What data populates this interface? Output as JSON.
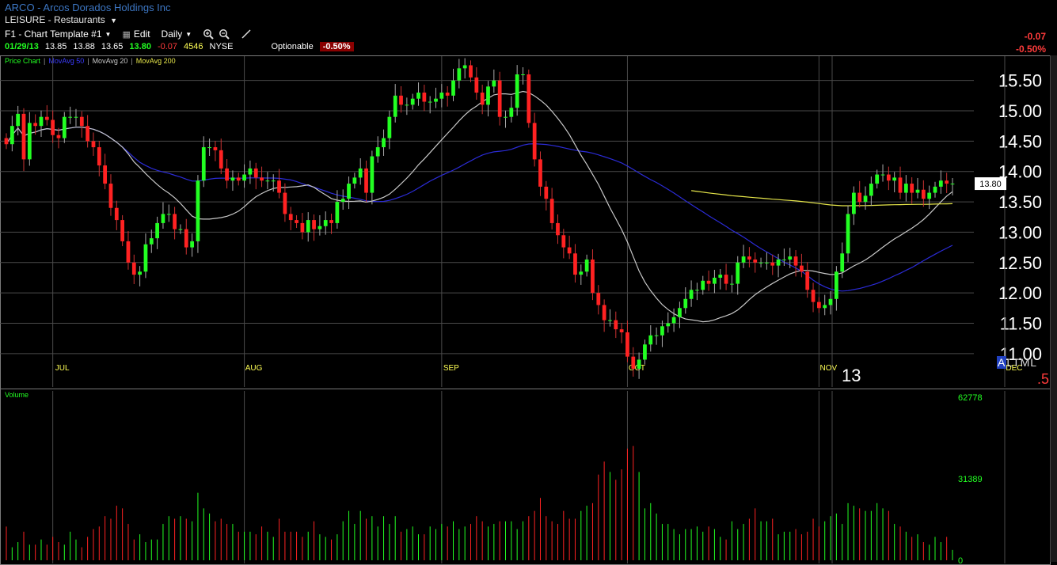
{
  "header": {
    "title": "ARCO - Arcos Dorados Holdings Inc",
    "sector": "LEISURE - Restaurants",
    "template": "F1 - Chart Template #1",
    "edit_label": "Edit",
    "period": "Daily",
    "optionable": "Optionable"
  },
  "quote": {
    "date": "01/29/13",
    "open": "13.85",
    "high": "13.88",
    "low": "13.65",
    "last": "13.80",
    "change": "-0.07",
    "volume": "4546",
    "exchange": "NYSE",
    "pct_change": "-0.50%"
  },
  "right_panel": {
    "change": "-0.07",
    "pct_change": "-0.50%"
  },
  "legend": {
    "price_chart": "Price Chart",
    "ma50": "MovAvg 50",
    "ma20": "MovAvg 20",
    "ma200": "MovAvg 200",
    "volume_label": "Volume"
  },
  "colors": {
    "up": "#22ff22",
    "down": "#ff2222",
    "ma50": "#2b2bd6",
    "ma20": "#c8c8c8",
    "ma200": "#e6e64a",
    "grid": "#4a4a4a"
  },
  "misc": {
    "alt_ml": "ALTML",
    "corner_13": "13",
    "corner_5": ".5"
  },
  "chart_data": [
    {
      "type": "candlestick",
      "ylim": [
        10.45,
        15.9
      ],
      "yticks": [
        "15.50",
        "15.00",
        "14.50",
        "14.00",
        "13.50",
        "13.00",
        "12.50",
        "12.00",
        "11.50",
        "11.00"
      ],
      "month_labels": [
        {
          "label": "JUL",
          "index": 8
        },
        {
          "label": "AUG",
          "index": 41
        },
        {
          "label": "SEP",
          "index": 75
        },
        {
          "label": "OCT",
          "index": 107
        },
        {
          "label": "NOV",
          "index": 140
        },
        {
          "label": "DEC",
          "index": 172
        }
      ],
      "last_price_label": "13.80",
      "closes": [
        14.45,
        14.75,
        14.95,
        14.2,
        14.8,
        14.75,
        14.9,
        14.85,
        14.6,
        14.55,
        14.9,
        14.9,
        14.9,
        14.75,
        14.5,
        14.4,
        14.1,
        13.8,
        13.4,
        13.2,
        12.85,
        12.5,
        12.3,
        12.35,
        12.8,
        12.9,
        13.15,
        13.3,
        13.3,
        13.05,
        13.05,
        12.75,
        12.85,
        13.85,
        14.4,
        14.4,
        14.35,
        14.05,
        13.85,
        13.9,
        13.85,
        13.95,
        14.05,
        13.9,
        13.85,
        13.85,
        13.85,
        13.65,
        13.3,
        13.2,
        13.15,
        13.0,
        13.2,
        13.05,
        13.1,
        13.2,
        13.15,
        13.5,
        13.55,
        13.8,
        13.9,
        14.05,
        13.65,
        14.25,
        14.4,
        14.55,
        14.9,
        15.25,
        15.1,
        15.1,
        15.2,
        15.3,
        15.15,
        15.15,
        15.2,
        15.3,
        15.25,
        15.5,
        15.7,
        15.75,
        15.55,
        15.3,
        15.1,
        15.4,
        15.5,
        14.9,
        14.9,
        15.05,
        15.6,
        15.6,
        14.8,
        14.2,
        13.75,
        13.55,
        13.15,
        12.95,
        12.75,
        12.65,
        12.3,
        12.35,
        12.55,
        12.0,
        11.8,
        11.55,
        11.55,
        11.4,
        11.35,
        10.95,
        10.75,
        10.9,
        11.15,
        11.3,
        11.3,
        11.45,
        11.5,
        11.6,
        11.75,
        11.9,
        12.05,
        12.05,
        12.2,
        12.15,
        12.25,
        12.3,
        12.15,
        12.15,
        12.5,
        12.6,
        12.55,
        12.5,
        12.5,
        12.5,
        12.45,
        12.55,
        12.55,
        12.6,
        12.45,
        12.35,
        12.05,
        11.85,
        11.75,
        11.8,
        11.9,
        12.35,
        12.65,
        13.3,
        13.65,
        13.5,
        13.6,
        13.8,
        13.95,
        13.95,
        13.85,
        13.9,
        13.65,
        13.8,
        13.65,
        13.7,
        13.55,
        13.65,
        13.75,
        13.85,
        13.8,
        13.8
      ],
      "volumes": [
        13000,
        5000,
        7000,
        11000,
        6000,
        6000,
        8000,
        6000,
        9000,
        7000,
        6000,
        11000,
        8000,
        5000,
        9000,
        12000,
        13000,
        17000,
        16000,
        21000,
        20000,
        14000,
        8000,
        10000,
        7000,
        8000,
        8000,
        14000,
        17000,
        16000,
        17000,
        16000,
        15000,
        26000,
        20000,
        18000,
        15000,
        16000,
        14000,
        14000,
        11000,
        11000,
        11000,
        10000,
        13000,
        11000,
        9000,
        16000,
        11000,
        11000,
        11000,
        9000,
        11000,
        15000,
        10000,
        9000,
        8000,
        10000,
        15000,
        19000,
        14000,
        19000,
        16000,
        17000,
        13000,
        17000,
        14000,
        17000,
        11000,
        12000,
        13000,
        10000,
        10000,
        13000,
        12000,
        14000,
        13000,
        15000,
        12000,
        13000,
        14000,
        17000,
        15000,
        13000,
        14000,
        15000,
        15000,
        15000,
        12000,
        15000,
        17000,
        19000,
        24000,
        17000,
        15000,
        14000,
        19000,
        16000,
        16000,
        19000,
        21000,
        22000,
        33000,
        38000,
        34000,
        31000,
        35000,
        43000,
        44000,
        34000,
        20000,
        22000,
        18000,
        14000,
        14000,
        12000,
        10000,
        12000,
        12000,
        13000,
        11000,
        13000,
        12000,
        9000,
        8000,
        15000,
        12000,
        14000,
        16000,
        20000,
        15000,
        15000,
        16000,
        10000,
        11000,
        11000,
        12000,
        10000,
        11000,
        16000,
        13000,
        15000,
        17000,
        18000,
        14000,
        22000,
        21000,
        20000,
        19000,
        19000,
        22000,
        20000,
        19000,
        14000,
        13000,
        11000,
        9000,
        10000,
        7000,
        6000,
        9000,
        7000,
        9000,
        4000,
        3000,
        4546
      ],
      "volume_ylim": [
        0,
        62778
      ],
      "volume_ticks": [
        "62778",
        "31389",
        "0"
      ]
    }
  ]
}
